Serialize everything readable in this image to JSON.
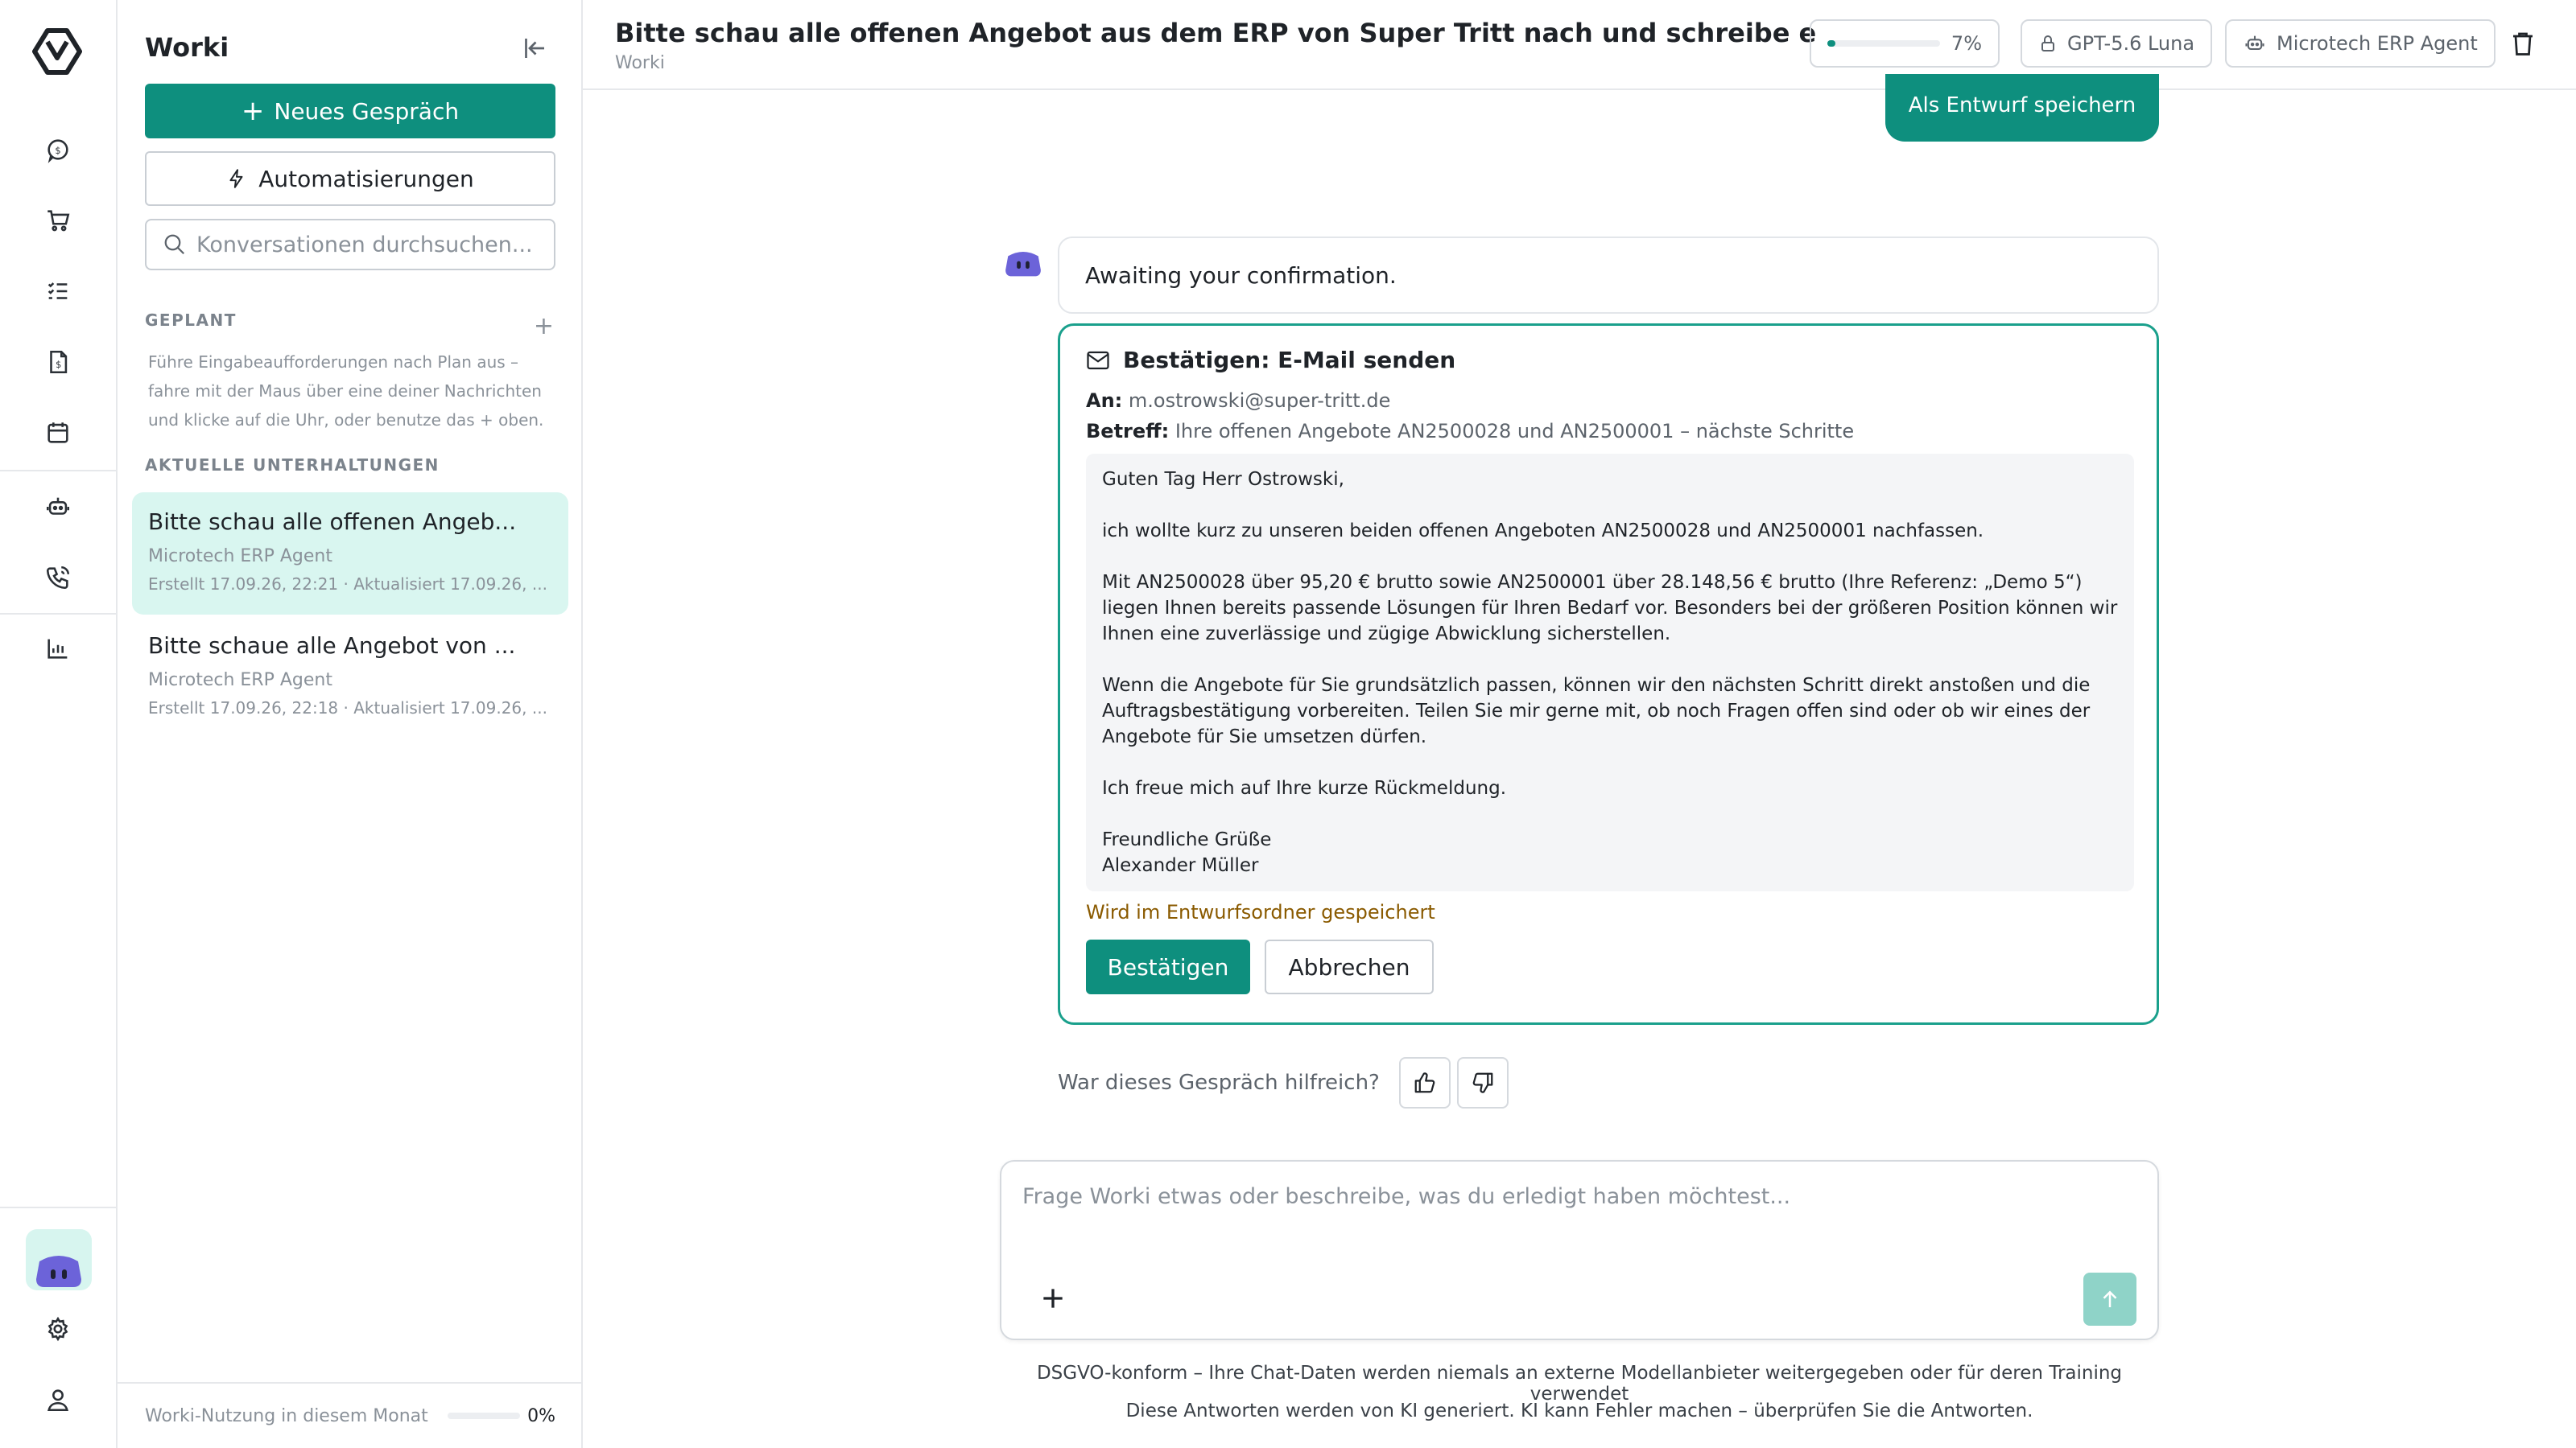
{
  "sidebar": {
    "title": "Worki",
    "new_chat": "Neues Gespräch",
    "automations": "Automatisierungen",
    "search_placeholder": "Konversationen durchsuchen...",
    "scheduled_label": "GEPLANT",
    "scheduled_desc": "Führe Eingabeaufforderungen nach Plan aus – fahre mit der Maus über eine deiner Nachrichten und klicke auf die Uhr, oder benutze das + oben.",
    "recent_label": "AKTUELLE UNTERHALTUNGEN",
    "conversations": [
      {
        "title": "Bitte schau alle offenen Angeb...",
        "agent": "Microtech ERP Agent",
        "meta": "Erstellt 17.09.26, 22:21 · Aktualisiert 17.09.26, ..."
      },
      {
        "title": "Bitte schaue alle Angebot von ...",
        "agent": "Microtech ERP Agent",
        "meta": "Erstellt 17.09.26, 22:18 · Aktualisiert 17.09.26, ..."
      }
    ],
    "usage_label": "Worki-Nutzung in diesem Monat",
    "usage_pct": "0%",
    "usage_fraction": 0
  },
  "header": {
    "title": "Bitte schau alle offenen Angebot aus dem ERP von Super Tritt nach und schreibe e",
    "subtitle": "Worki",
    "usage_pct": "7%",
    "usage_fraction": 0.07,
    "model": "GPT-5.6 Luna",
    "agent": "Microtech ERP Agent"
  },
  "chat": {
    "draft_button": "Als Entwurf speichern",
    "assistant_message": "Awaiting your confirmation.",
    "confirm": {
      "title": "Bestätigen: E-Mail senden",
      "to_label": "An:",
      "to_value": "m.ostrowski@super-tritt.de",
      "subject_label": "Betreff:",
      "subject_value": "Ihre offenen Angebote AN2500028 und AN2500001 – nächste Schritte",
      "body": {
        "greeting": "Guten Tag Herr Ostrowski,",
        "p1": "ich wollte kurz zu unseren beiden offenen Angeboten AN2500028 und AN2500001 nachfassen.",
        "p2": "Mit AN2500028 über 95,20 € brutto sowie AN2500001 über 28.148,56 € brutto (Ihre Referenz: „Demo 5“) liegen Ihnen bereits passende Lösungen für Ihren Bedarf vor. Besonders bei der größeren Position können wir Ihnen eine zuverlässige und zügige Abwicklung sicherstellen.",
        "p3": "Wenn die Angebote für Sie grundsätzlich passen, können wir den nächsten Schritt direkt anstoßen und die Auftragsbestätigung vorbereiten. Teilen Sie mir gerne mit, ob noch Fragen offen sind oder ob wir eines der Angebote für Sie umsetzen dürfen.",
        "p4": "Ich freue mich auf Ihre kurze Rückmeldung.",
        "closing": "Freundliche Grüße",
        "signature": "Alexander Müller"
      },
      "note": "Wird im Entwurfsordner gespeichert",
      "confirm_button": "Bestätigen",
      "cancel_button": "Abbrechen"
    },
    "feedback_question": "War dieses Gespräch hilfreich?"
  },
  "composer": {
    "placeholder": "Frage Worki etwas oder beschreibe, was du erledigt haben möchtest..."
  },
  "footer": {
    "line1": "DSGVO-konform – Ihre Chat-Daten werden niemals an externe Modellanbieter weitergegeben oder für deren Training verwendet",
    "line2": "Diese Antworten werden von KI generiert. KI kann Fehler machen – überprüfen Sie die Antworten."
  },
  "colors": {
    "accent": "#0e8f7e",
    "accent_light": "#d9f6f0",
    "bot": "#6c63d9"
  }
}
